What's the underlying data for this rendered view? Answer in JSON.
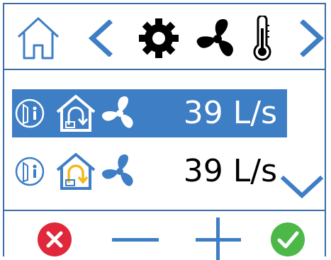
{
  "header": {
    "icons": [
      "home-icon",
      "chevron-left-icon",
      "gear-icon",
      "fan-icon",
      "thermometer-icon",
      "chevron-right-icon"
    ]
  },
  "rows": [
    {
      "value": "39 L/s",
      "selected": true,
      "icons": [
        "door-person-icon",
        "house-return-air-icon",
        "fan-icon"
      ]
    },
    {
      "value": "39 L/s",
      "selected": false,
      "icons": [
        "door-person-icon",
        "house-return-air-icon",
        "fan-icon"
      ]
    }
  ],
  "footer": {
    "icons": [
      "cancel-icon",
      "minus-icon",
      "plus-icon",
      "confirm-icon"
    ]
  },
  "colors": {
    "accent": "#3d7ec4",
    "border": "#3a6ea5",
    "cancel": "#e0283a",
    "confirm": "#4cb848",
    "highlight": "#f2b81c"
  }
}
